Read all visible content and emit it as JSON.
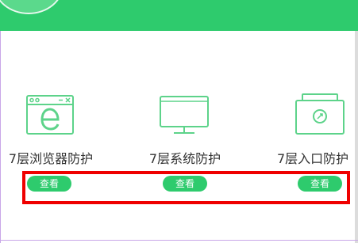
{
  "colors": {
    "accent": "#2ecb6d",
    "icon_stroke": "#5dd38a",
    "highlight": "#ef0000",
    "label_text": "#333333"
  },
  "features": [
    {
      "label": "7层浏览器防护",
      "icon": "browser-window-e-icon",
      "button": "查看"
    },
    {
      "label": "7层系统防护",
      "icon": "monitor-icon",
      "button": "查看"
    },
    {
      "label": "7层入口防护",
      "icon": "entry-window-icon",
      "button": "查看"
    }
  ]
}
